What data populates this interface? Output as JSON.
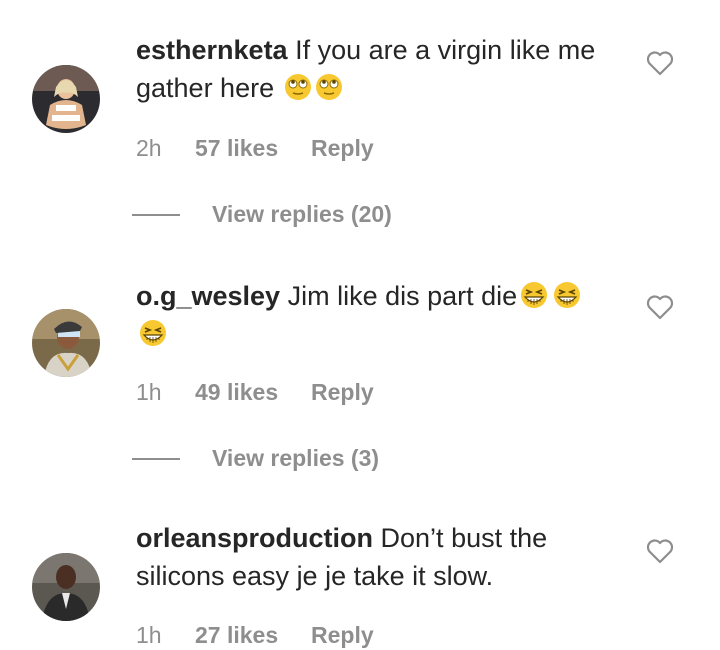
{
  "comments": [
    {
      "username": "esthernketa",
      "text": "If you are a virgin like me gather here",
      "emoji": "rolling-eyes-emoji",
      "time": "2h",
      "likes": "57 likes",
      "reply": "Reply",
      "view_replies": "View replies (20)"
    },
    {
      "username": "o.g_wesley",
      "text": "Jim like dis part die",
      "emoji": "grinning-squinting-emoji",
      "time": "1h",
      "likes": "49 likes",
      "reply": "Reply",
      "view_replies": "View replies (3)"
    },
    {
      "username": "orleansproduction",
      "text": "Don’t bust the silicons easy je je take it slow.",
      "time": "1h",
      "likes": "27 likes",
      "reply": "Reply"
    }
  ],
  "colors": {
    "text": "#262626",
    "secondary": "#8e8e8e",
    "emoji_yellow": "#f7c830"
  }
}
